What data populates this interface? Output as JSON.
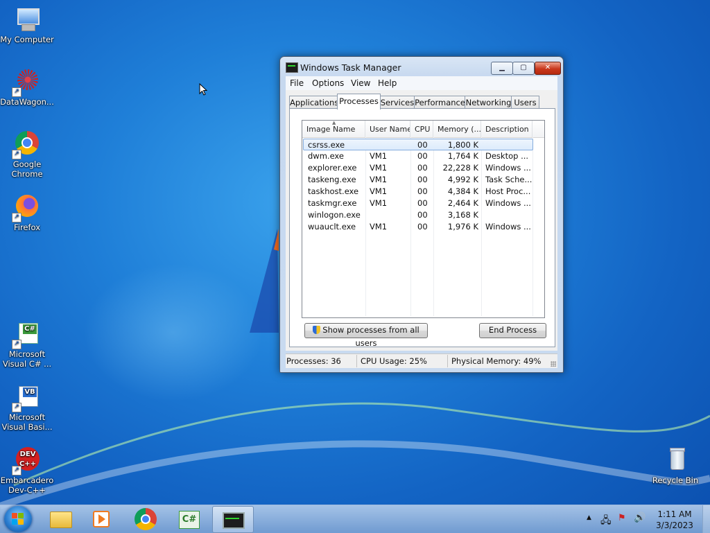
{
  "desktop": {
    "icons": [
      {
        "label": "My Computer"
      },
      {
        "label": "DataWagon..."
      },
      {
        "label": "Google Chrome"
      },
      {
        "label": "Firefox"
      },
      {
        "label": "Microsoft Visual C# ..."
      },
      {
        "label": "Microsoft Visual Basi..."
      },
      {
        "label": "Embarcadero Dev-C++"
      },
      {
        "label": "Recycle Bin"
      }
    ]
  },
  "window": {
    "title": "Windows Task Manager",
    "menu": [
      "File",
      "Options",
      "View",
      "Help"
    ],
    "tabs": [
      "Applications",
      "Processes",
      "Services",
      "Performance",
      "Networking",
      "Users"
    ],
    "active_tab": "Processes",
    "columns": [
      "Image Name",
      "User Name",
      "CPU",
      "Memory (...",
      "Description"
    ],
    "rows": [
      {
        "image": "csrss.exe",
        "user": "",
        "cpu": "00",
        "memory": "1,800 K",
        "desc": ""
      },
      {
        "image": "dwm.exe",
        "user": "VM1",
        "cpu": "00",
        "memory": "1,764 K",
        "desc": "Desktop ..."
      },
      {
        "image": "explorer.exe",
        "user": "VM1",
        "cpu": "00",
        "memory": "22,228 K",
        "desc": "Windows ..."
      },
      {
        "image": "taskeng.exe",
        "user": "VM1",
        "cpu": "00",
        "memory": "4,992 K",
        "desc": "Task Sche..."
      },
      {
        "image": "taskhost.exe",
        "user": "VM1",
        "cpu": "00",
        "memory": "4,384 K",
        "desc": "Host Proc..."
      },
      {
        "image": "taskmgr.exe",
        "user": "VM1",
        "cpu": "00",
        "memory": "2,464 K",
        "desc": "Windows ..."
      },
      {
        "image": "winlogon.exe",
        "user": "",
        "cpu": "00",
        "memory": "3,168 K",
        "desc": ""
      },
      {
        "image": "wuauclt.exe",
        "user": "VM1",
        "cpu": "00",
        "memory": "1,976 K",
        "desc": "Windows ..."
      }
    ],
    "selected_row": 0,
    "show_all_button": "Show processes from all users",
    "end_process_button": "End Process",
    "status": {
      "processes": "Processes: 36",
      "cpu": "CPU Usage: 25%",
      "memory": "Physical Memory: 49%"
    }
  },
  "taskbar": {
    "clock_time": "1:11 AM",
    "clock_date": "3/3/2023",
    "pinned": [
      "file-explorer",
      "media-player",
      "google-chrome",
      "visual-csharp",
      "task-manager"
    ]
  },
  "colors": {
    "desktop_blue": "#1f7fd8",
    "selection_border": "#84acdd",
    "close_red": "#c9381c"
  }
}
